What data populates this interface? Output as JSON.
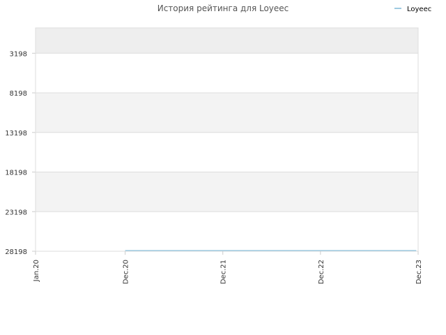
{
  "chart_data": {
    "type": "line",
    "title": "История рейтинга для Loyeec",
    "xlabel": "",
    "ylabel": "",
    "x_ticks": [
      "Jan.20",
      "Dec.20",
      "Dec.21",
      "Dec.22",
      "Dec.23"
    ],
    "y_ticks": [
      "3198",
      "8198",
      "13198",
      "18198",
      "23198",
      "28198"
    ],
    "y_tick_values": [
      3198,
      8198,
      13198,
      18198,
      23198,
      28198
    ],
    "ylim": [
      28198,
      0
    ],
    "y_inverted": true,
    "grid": true,
    "legend_position": "top-right",
    "series": [
      {
        "name": "Loyeec",
        "color": "#9ecae1",
        "points": [
          {
            "x": "2020-12-01",
            "y": 28198
          },
          {
            "x": "2023-11-24",
            "y": 28198
          }
        ]
      }
    ]
  }
}
